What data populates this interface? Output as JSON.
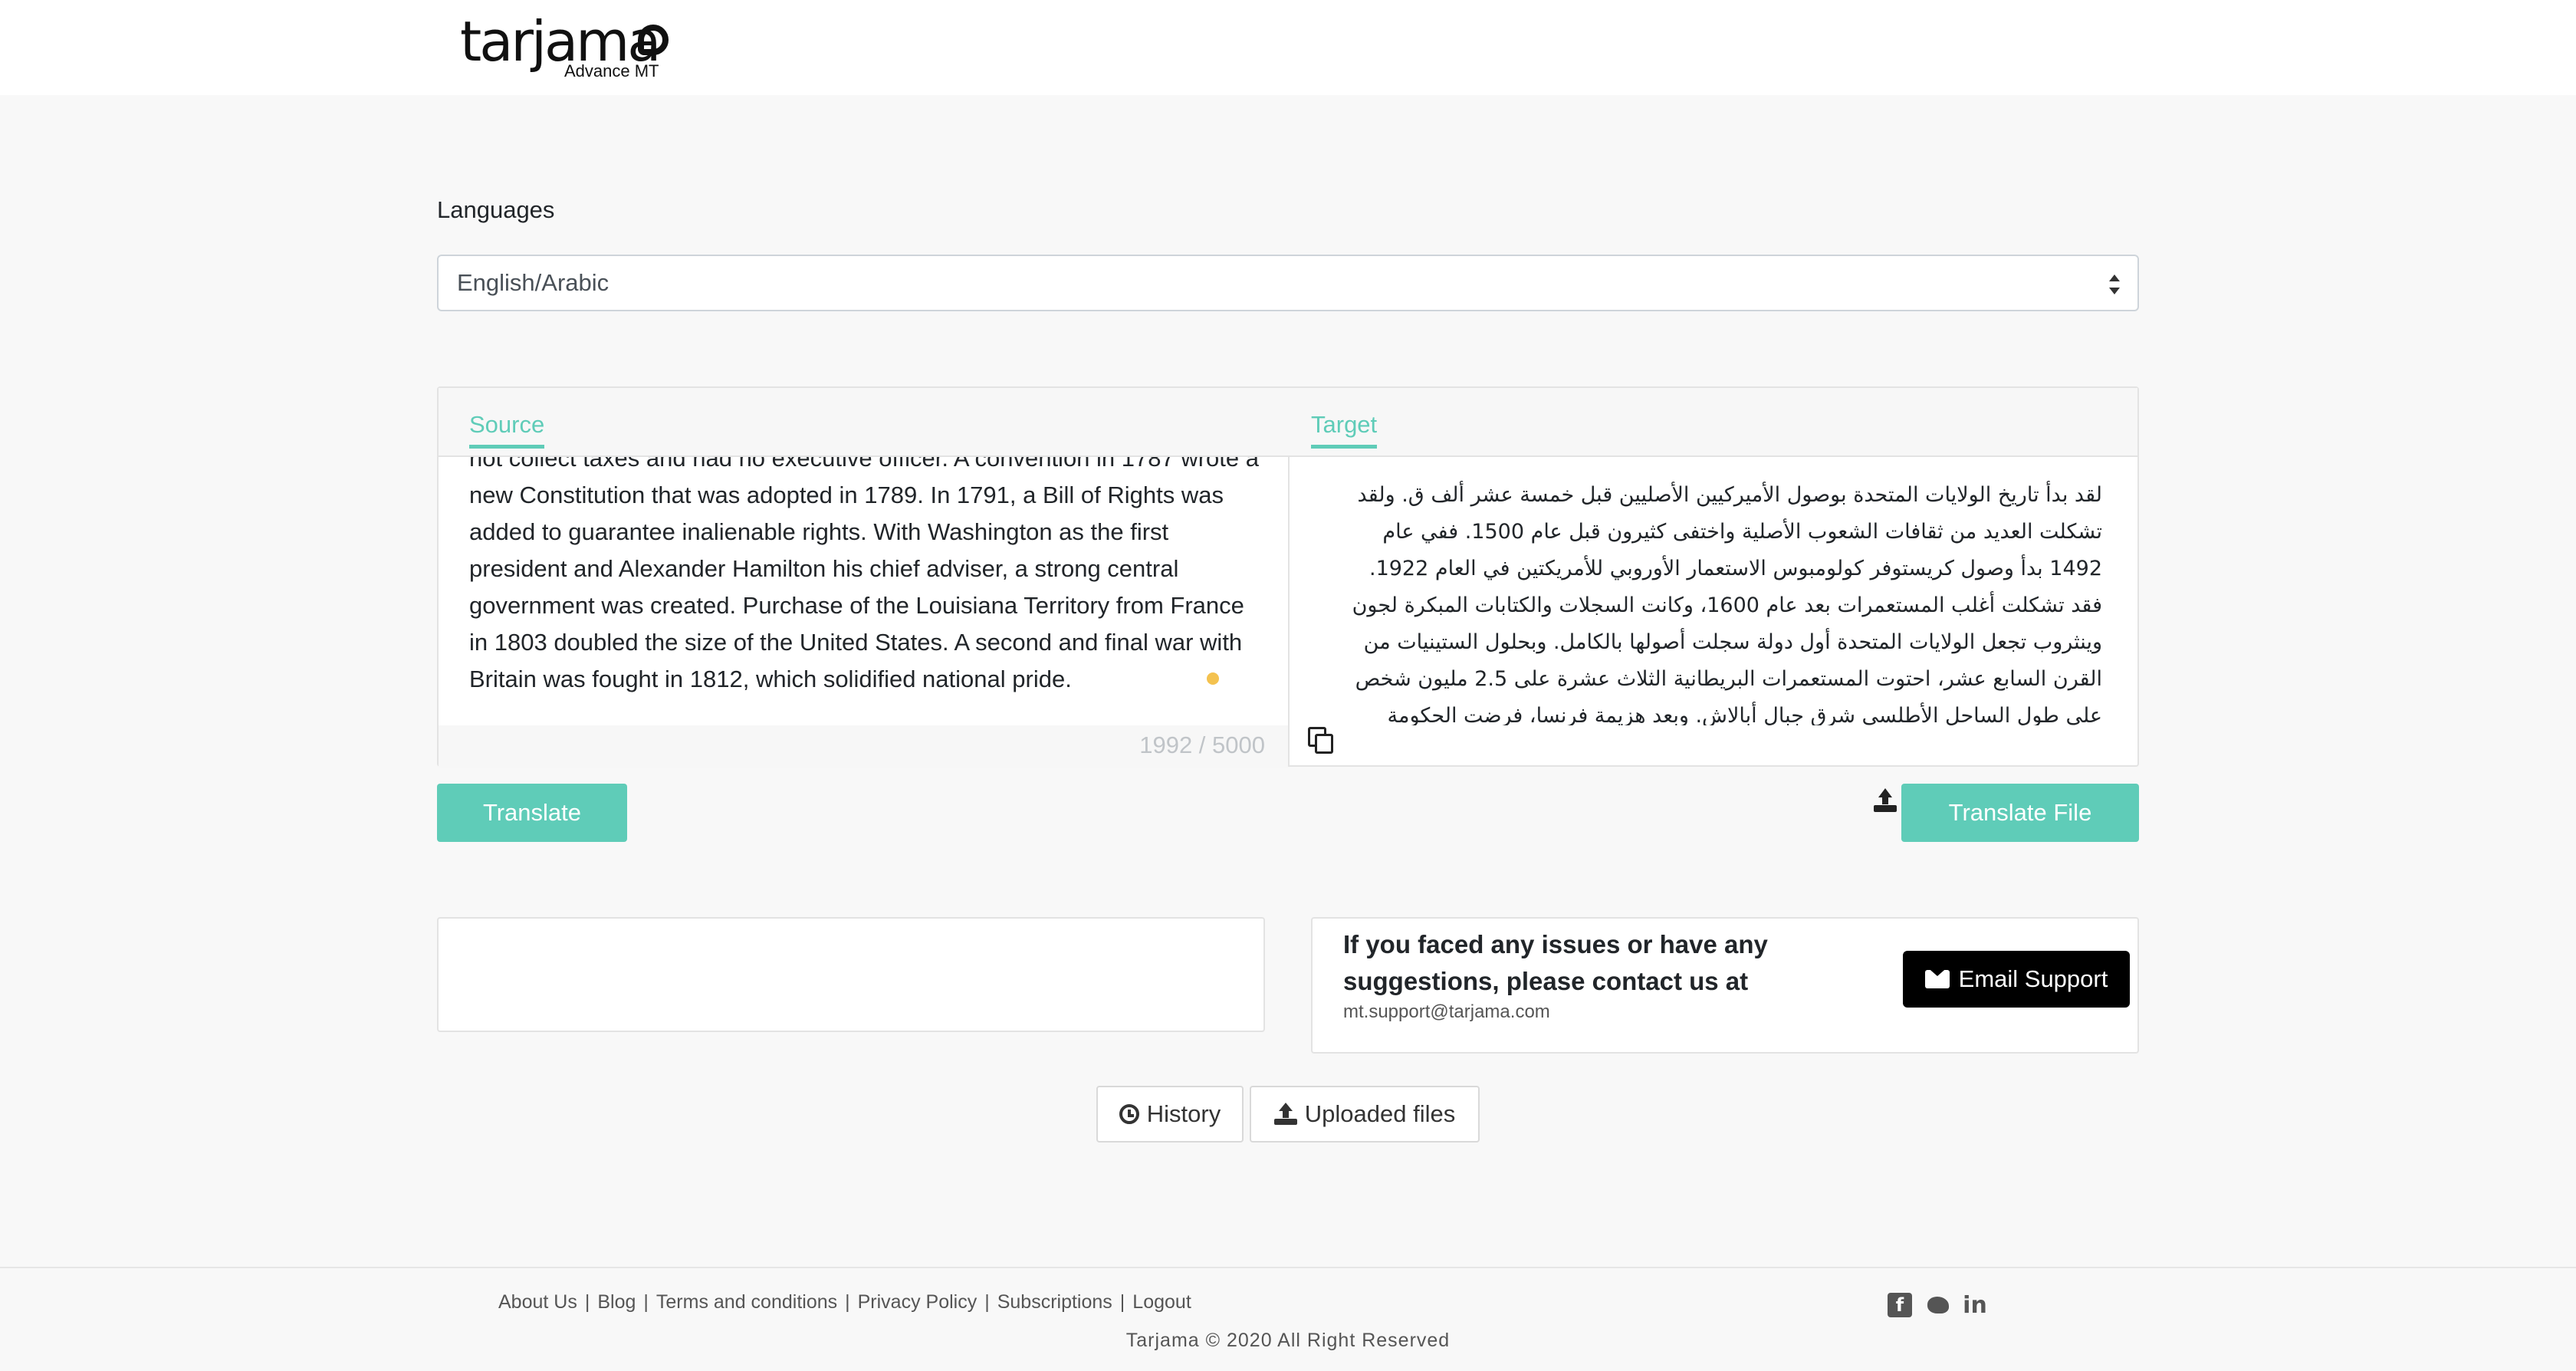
{
  "header": {
    "logo_text": "tarjama",
    "logo_subtitle": "Advance MT"
  },
  "languages": {
    "label": "Languages",
    "selected": "English/Arabic"
  },
  "translator": {
    "tabs": {
      "source": "Source",
      "target": "Target"
    },
    "source_text": "not collect taxes and had no executive officer. A convention in 1787 wrote a new Constitution that was adopted in 1789. In 1791, a Bill of Rights was added to guarantee inalienable rights. With Washington as the first president and Alexander Hamilton his chief adviser, a strong central government was created. Purchase of the Louisiana Territory from France in 1803 doubled the size of the United States. A second and final war with Britain was fought in 1812, which solidified national pride.",
    "char_count": "1992 / 5000",
    "target_text": "لقد بدأ تاريخ الولايات المتحدة بوصول الأميركيين الأصليين قبل خمسة عشر ألف ق. ولقد تشكلت العديد من ثقافات الشعوب الأصلية واختفى كثيرون قبل عام 1500. ففي عام 1492 بدأ وصول كريستوفر كولومبوس الاستعمار الأوروبي للأمريكتين في العام 1922. فقد تشكلت أغلب المستعمرات بعد عام 1600، وكانت السجلات والكتابات المبكرة لجون وينثروب تجعل الولايات المتحدة أول دولة سجلت أصولها بالكامل. وبحلول الستينيات من القرن السابع عشر، احتوت المستعمرات البريطانية الثلاث عشرة على 2.5 مليون شخص على طول الساحل الأطلسي شرق جبال أبالاش. وبعد هزيمة فرنسا، فرضت الحكومة البريطانية سلسلة من الضرائب، بما في ذلك"
  },
  "actions": {
    "translate": "Translate",
    "translate_file": "Translate File"
  },
  "contact": {
    "message": "If you faced any issues or have any suggestions, please contact us at",
    "email": "mt.support@tarjama.com",
    "button": "Email Support"
  },
  "nav_buttons": {
    "history": "History",
    "uploaded_files": "Uploaded files"
  },
  "footer": {
    "links": [
      "About Us",
      "Blog",
      "Terms and conditions",
      "Privacy Policy",
      "Subscriptions",
      "Logout"
    ],
    "separator": "|",
    "social": {
      "facebook": "f",
      "linkedin": "in"
    },
    "copyright": "Tarjama © 2020 All Right Reserved"
  },
  "colors": {
    "accent": "#5fccb8",
    "background": "#f8f8f8",
    "email_button": "#000000"
  },
  "icons": [
    "logo-bubble-icon",
    "select-arrows-icon",
    "copy-icon",
    "upload-icon",
    "envelope-icon",
    "history-icon",
    "upload-small-icon",
    "facebook-icon",
    "twitter-icon",
    "linkedin-icon"
  ]
}
